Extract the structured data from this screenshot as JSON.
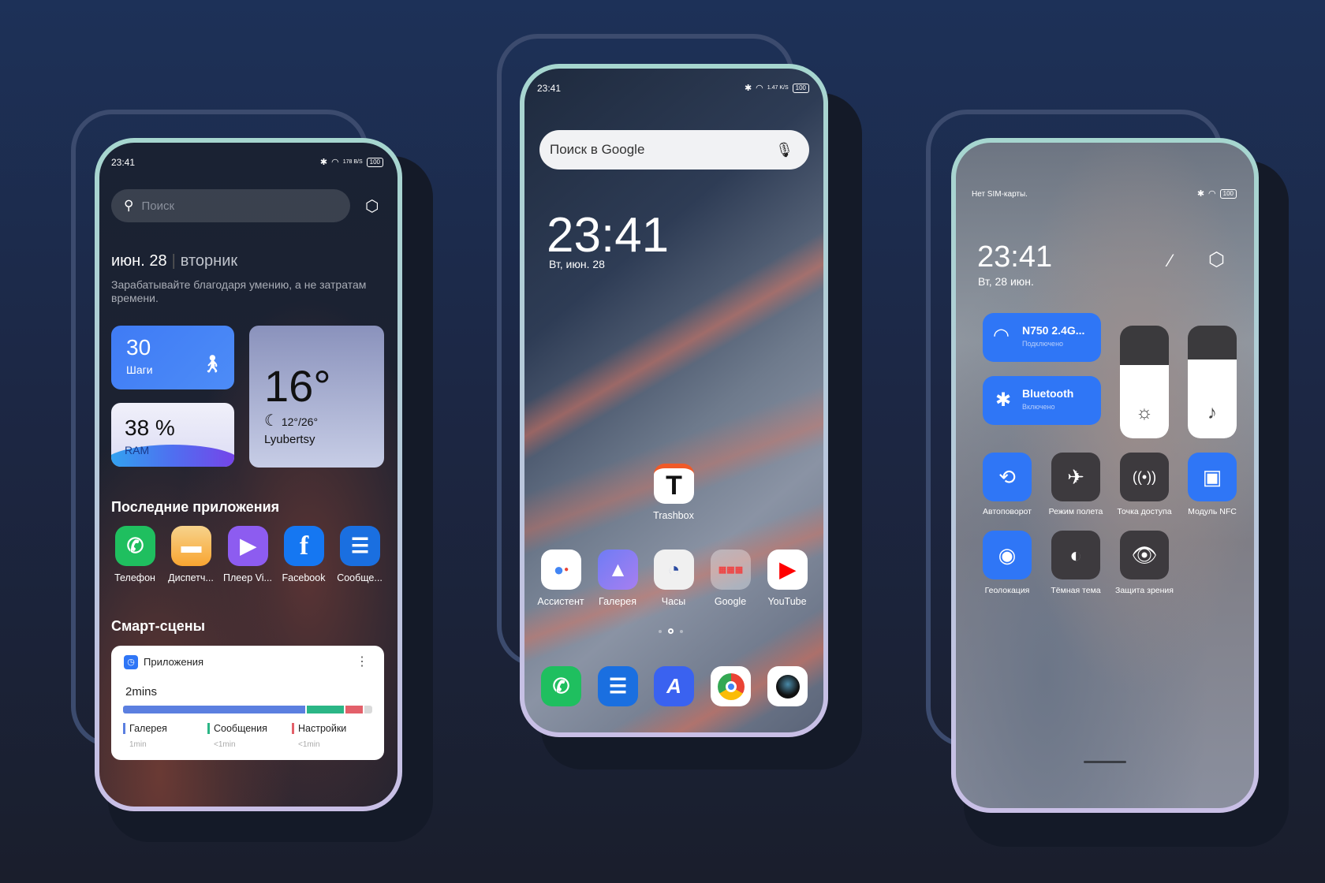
{
  "left": {
    "status": {
      "time": "23:41",
      "speed": "178 B/S",
      "battery": "100"
    },
    "search_placeholder": "Поиск",
    "date": "июн. 28",
    "weekday": "вторник",
    "quote": "Зарабатывайте благодаря умению, а не затратам времени.",
    "steps": {
      "value": "30",
      "label": "Шаги"
    },
    "ram": {
      "value": "38 %",
      "label": "RAM",
      "percent": 38
    },
    "weather": {
      "temp": "16°",
      "range": "12°/26°",
      "city": "Lyubertsy"
    },
    "recent_title": "Последние приложения",
    "recent_apps": [
      {
        "label": "Телефон",
        "color": "#1fbf5f",
        "icon": "phone-icon"
      },
      {
        "label": "Диспетч...",
        "color": "#f8a531",
        "icon": "folder-icon"
      },
      {
        "label": "Плеер Vi...",
        "color": "#8d5cf0",
        "icon": "play-icon"
      },
      {
        "label": "Facebook",
        "color": "#1577f2",
        "icon": "facebook-icon"
      },
      {
        "label": "Сообще...",
        "color": "#1a6fe0",
        "icon": "message-icon"
      }
    ],
    "smart_title": "Смарт-сцены",
    "usage": {
      "title": "Приложения",
      "total": "2mins",
      "items": [
        {
          "name": "Галерея",
          "time": "1min",
          "color": "#5b7fe0",
          "share": 73
        },
        {
          "name": "Сообщения",
          "time": "<1min",
          "color": "#2bb686",
          "share": 15
        },
        {
          "name": "Настройки",
          "time": "<1min",
          "color": "#e3606a",
          "share": 7
        }
      ],
      "rest_color": "#dadada"
    }
  },
  "center": {
    "status": {
      "time": "23:41",
      "speed": "1.47 K/S",
      "battery": "100"
    },
    "search_placeholder": "Поиск в Google",
    "clock": "23:41",
    "date": "Вт, июн. 28",
    "trashbox": "Trashbox",
    "apps": [
      {
        "label": "Ассистент",
        "icon": "assistant-icon"
      },
      {
        "label": "Галерея",
        "icon": "gallery-icon"
      },
      {
        "label": "Часы",
        "icon": "clock-icon"
      },
      {
        "label": "Google",
        "icon": "google-folder-icon"
      },
      {
        "label": "YouTube",
        "icon": "youtube-icon"
      }
    ],
    "dock": [
      "phone-icon",
      "messages-icon",
      "notes-icon",
      "chrome-icon",
      "camera-icon"
    ],
    "page_count": 3,
    "current_page": 2
  },
  "right": {
    "sim": "Нет SIM-карты.",
    "battery": "100",
    "clock": "23:41",
    "date": "Вт, 28 июн.",
    "wifi": {
      "name": "N750 2.4G...",
      "status": "Подключено"
    },
    "bluetooth": {
      "name": "Bluetooth",
      "status": "Включено"
    },
    "brightness": 65,
    "volume": 70,
    "toggles": [
      {
        "label": "Автоповорот",
        "active": true,
        "icon": "autorotate-icon"
      },
      {
        "label": "Режим полета",
        "active": false,
        "icon": "airplane-icon"
      },
      {
        "label": "Точка доступа",
        "active": false,
        "icon": "hotspot-icon"
      },
      {
        "label": "Модуль NFC",
        "active": true,
        "icon": "nfc-icon"
      },
      {
        "label": "Геолокация",
        "active": true,
        "icon": "location-icon"
      },
      {
        "label": "Тёмная тема",
        "active": false,
        "icon": "dark-theme-icon"
      },
      {
        "label": "Защита зрения",
        "active": false,
        "icon": "eye-protection-icon"
      }
    ]
  },
  "colors": {
    "accent": "#2f76f6",
    "background": "#1c2a48"
  }
}
